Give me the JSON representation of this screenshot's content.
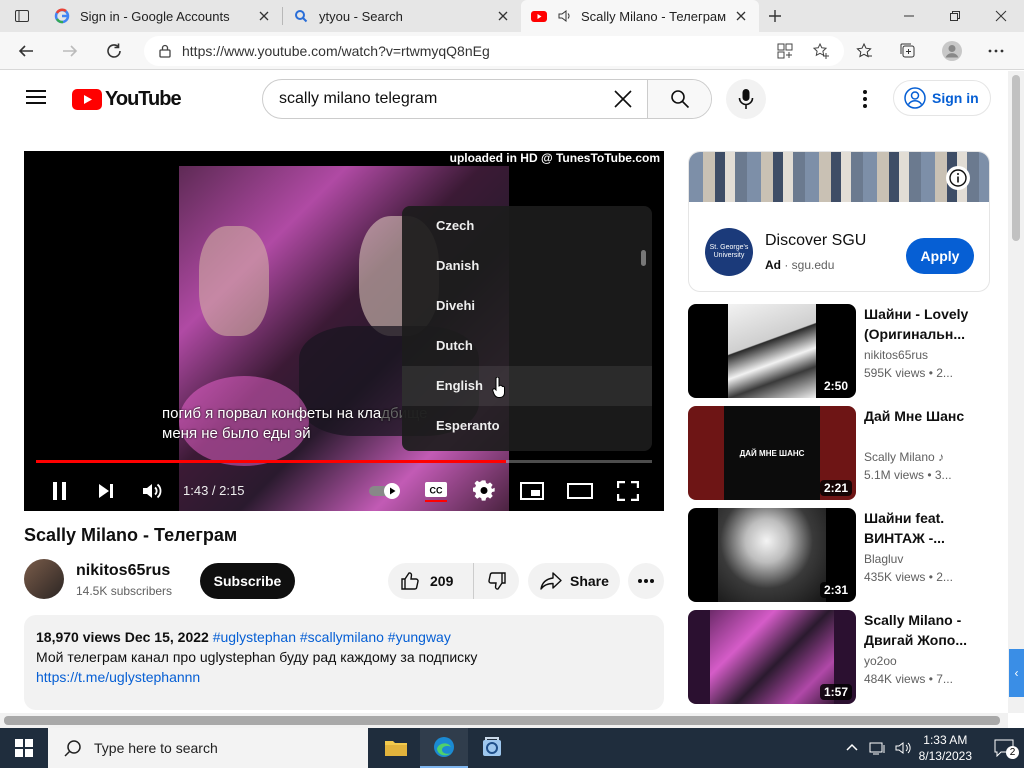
{
  "browser": {
    "tabs": [
      {
        "title": "Sign in - Google Accounts",
        "icon": "google-icon"
      },
      {
        "title": "ytyou - Search",
        "icon": "search-icon"
      },
      {
        "title": "Scally Milano - Телеграм - Y",
        "icon": "youtube-icon",
        "audio": true,
        "active": true
      }
    ],
    "url": "https://www.youtube.com/watch?v=rtwmyqQ8nEg"
  },
  "youtube": {
    "logo_text": "YouTube",
    "search_query": "scally milano telegram",
    "signin_label": "Sign in"
  },
  "player": {
    "watermark": "uploaded in HD @ TunesToTube.com",
    "caption_line1": "погиб я порвал конфеты на кла",
    "caption_line1_cont": "дбище",
    "caption_line2": "меня не было еды эй",
    "time_display": "1:43 / 2:15",
    "progress_fraction": 0.763,
    "buffered_fraction": 0.76,
    "subtitle_languages": [
      "Czech",
      "Danish",
      "Divehi",
      "Dutch",
      "English",
      "Esperanto"
    ],
    "hovered_language": "English"
  },
  "video": {
    "title": "Scally Milano - Телеграм",
    "channel": "nikitos65rus",
    "subscribers": "14.5K subscribers",
    "subscribe_label": "Subscribe",
    "likes": "209",
    "share_label": "Share",
    "views_date": "18,970 views  Dec 15, 2022",
    "tags": "#uglystephan #scallymilano #yungway",
    "description_line": "Мой телеграм канал про uglystephan буду рад  каждому за подписку",
    "link": "https://t.me/uglystephannn"
  },
  "ad": {
    "title": "Discover SGU",
    "ad_label": "Ad",
    "domain": "sgu.edu",
    "apply_label": "Apply",
    "logo_text": "St. George's University"
  },
  "recommendations": [
    {
      "title": "Шайни - Lovely (Оригинальн...",
      "channel": "nikitos65rus",
      "views": "595K views  • 2...",
      "duration": "2:50"
    },
    {
      "title": "Дай Мне Шанс",
      "channel": "Scally Milano",
      "views": "5.1M views  • 3...",
      "duration": "2:21",
      "thumb_text": "ДАЙ МНЕ ШАНС"
    },
    {
      "title": "Шайни feat. ВИНТАЖ -...",
      "channel": "Blagluv",
      "views": "435K views  • 2...",
      "duration": "2:31"
    },
    {
      "title": "Scally Milano - Двигай Жопо...",
      "channel": "yo2oo",
      "views": "484K views  • 7...",
      "duration": "1:57"
    }
  ],
  "taskbar": {
    "search_placeholder": "Type here to search",
    "time": "1:33 AM",
    "date": "8/13/2023",
    "notifications": "2"
  }
}
